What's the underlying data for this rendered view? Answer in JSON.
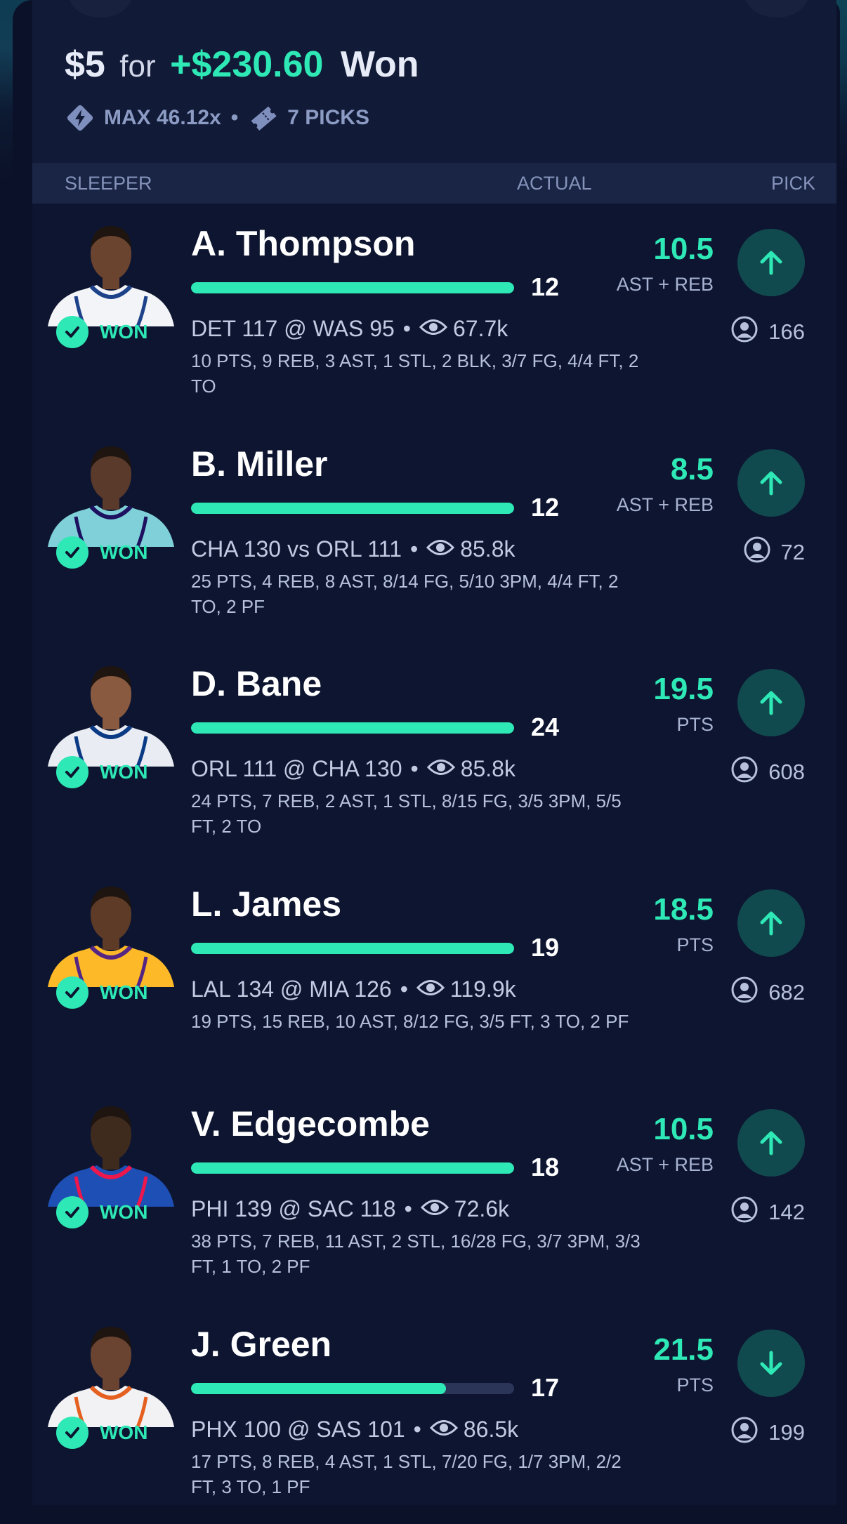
{
  "header": {
    "stake": "$5",
    "for_word": "for",
    "winnings": "+$230.60",
    "status": "Won",
    "max": "MAX 46.12x",
    "picks": "7 PICKS"
  },
  "columns": {
    "sleeper": "SLEEPER",
    "actual": "ACTUAL",
    "pick": "PICK"
  },
  "colors": {
    "accent": "#2ee8b6",
    "background": "#0b1128",
    "card": "#0d1530"
  },
  "picks": [
    {
      "name": "A. Thompson",
      "actual": "12",
      "progress": 1.0,
      "line": "10.5",
      "stat": "AST + REB",
      "direction": "up",
      "result": "WON",
      "game": "DET 117 @ WAS 95",
      "views": "67.7k",
      "box": "10 PTS, 9 REB, 3 AST, 1 STL, 2 BLK, 3/7 FG, 4/4 FT, 2 TO",
      "pickers": "166",
      "jersey": "#f2f4f7",
      "trim": "#1d428a",
      "skin": "#6b4430"
    },
    {
      "name": "B. Miller",
      "actual": "12",
      "progress": 1.0,
      "line": "8.5",
      "stat": "AST + REB",
      "direction": "up",
      "result": "WON",
      "game": "CHA 130 vs ORL 111",
      "views": "85.8k",
      "box": "25 PTS, 4 REB, 8 AST, 8/14 FG, 5/10 3PM, 4/4 FT, 2 TO, 2 PF",
      "pickers": "72",
      "jersey": "#7fd0d8",
      "trim": "#1d1160",
      "skin": "#5a3a2a"
    },
    {
      "name": "D. Bane",
      "actual": "24",
      "progress": 1.0,
      "line": "19.5",
      "stat": "PTS",
      "direction": "up",
      "result": "WON",
      "game": "ORL 111 @ CHA 130",
      "views": "85.8k",
      "box": "24 PTS, 7 REB, 2 AST, 1 STL, 8/15 FG, 3/5 3PM, 5/5 FT, 2 TO",
      "pickers": "608",
      "jersey": "#e9ecf3",
      "trim": "#0b3a84",
      "skin": "#8a5a40"
    },
    {
      "name": "L. James",
      "actual": "19",
      "progress": 1.0,
      "line": "18.5",
      "stat": "PTS",
      "direction": "up",
      "result": "WON",
      "game": "LAL 134 @ MIA 126",
      "views": "119.9k",
      "box": "19 PTS, 15 REB, 10 AST, 8/12 FG, 3/5 FT, 3 TO, 2 PF",
      "pickers": "682",
      "jersey": "#fdb927",
      "trim": "#552583",
      "skin": "#5e3b27"
    },
    {
      "name": "V. Edgecombe",
      "actual": "18",
      "progress": 1.0,
      "line": "10.5",
      "stat": "AST + REB",
      "direction": "up",
      "result": "WON",
      "game": "PHI 139 @ SAC 118",
      "views": "72.6k",
      "box": "38 PTS, 7 REB, 11 AST, 2 STL, 16/28 FG, 3/7 3PM, 3/3 FT, 1 TO, 2 PF",
      "pickers": "142",
      "jersey": "#1d4fb5",
      "trim": "#ed174c",
      "skin": "#3f2a1e"
    },
    {
      "name": "J. Green",
      "actual": "17",
      "progress": 0.79,
      "line": "21.5",
      "stat": "PTS",
      "direction": "down",
      "result": "WON",
      "game": "PHX 100 @ SAS 101",
      "views": "86.5k",
      "box": "17 PTS, 8 REB, 4 AST, 1 STL, 7/20 FG, 1/7 3PM, 2/2 FT, 3 TO, 1 PF",
      "pickers": "199",
      "jersey": "#f2f2f5",
      "trim": "#e56020",
      "skin": "#6a4431"
    }
  ]
}
